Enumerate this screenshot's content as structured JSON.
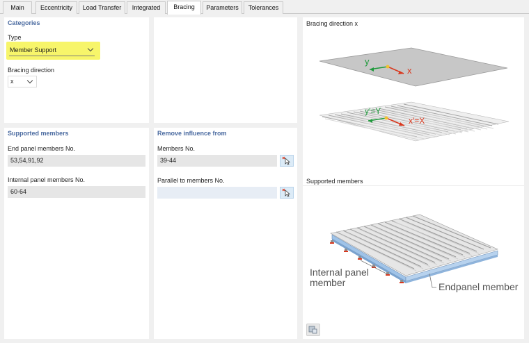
{
  "tabs": [
    {
      "label": "Main",
      "active": false
    },
    {
      "label": "Eccentricity",
      "active": false
    },
    {
      "label": "Load Transfer",
      "active": false
    },
    {
      "label": "Integrated",
      "active": false
    },
    {
      "label": "Bracing",
      "active": true
    },
    {
      "label": "Parameters",
      "active": false
    },
    {
      "label": "Tolerances",
      "active": false
    }
  ],
  "categories": {
    "title": "Categories",
    "type_label": "Type",
    "type_value": "Member Support",
    "bracing_direction_label": "Bracing direction",
    "bracing_direction_value": "x"
  },
  "supported_members": {
    "title": "Supported members",
    "end_label": "End panel members No.",
    "end_value": "53,54,91,92",
    "internal_label": "Internal panel members No.",
    "internal_value": "60-64"
  },
  "remove_influence": {
    "title": "Remove influence from",
    "members_label": "Members No.",
    "members_value": "39-44",
    "parallel_label": "Parallel to members No.",
    "parallel_value": ""
  },
  "graphics": {
    "bracing_title": "Bracing direction x",
    "axis_y": "y",
    "axis_x": "x",
    "axis_y_global": "y′=Y",
    "axis_x_global": "x′=X",
    "supported_title": "Supported members",
    "internal_panel_line1": "Internal panel",
    "internal_panel_line2": "member",
    "endpanel_label": "Endpanel member"
  },
  "colors": {
    "highlight": "#f7f56a",
    "section_title": "#4a6aa0",
    "axis_red": "#d9381e",
    "axis_green": "#1f9a3c",
    "node_yellow": "#f2c12e",
    "beam_blue": "#9fc3e8"
  }
}
